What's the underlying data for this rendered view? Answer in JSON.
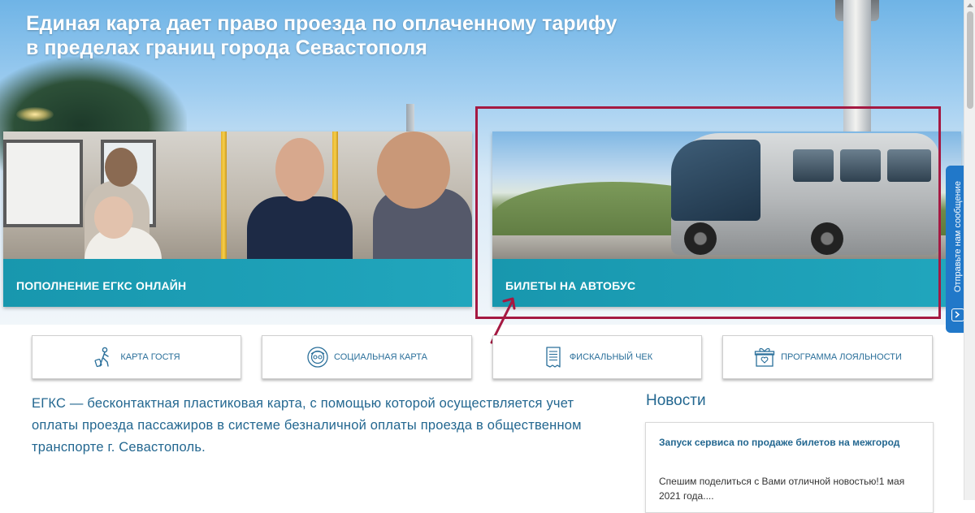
{
  "hero": {
    "title_line_1": "Единая карта дает право проезда по оплаченному тарифу",
    "title_line_2": "в пределах границ города Севастополя"
  },
  "cards": [
    {
      "label": "ПОПОЛНЕНИЕ ЕГКС ОНЛАЙН",
      "photo": "passengers-on-bus"
    },
    {
      "label": "БИЛЕТЫ НА АВТОБУС",
      "photo": "coach-bus-landscape"
    }
  ],
  "highlight": {
    "color": "#a51942"
  },
  "quick_links": [
    {
      "label": "КАРТА ГОСТЯ",
      "icon": "traveler-luggage-icon"
    },
    {
      "label": "СОЦИАЛЬНАЯ КАРТА",
      "icon": "elderly-person-icon"
    },
    {
      "label": "ФИСКАЛЬНЫЙ ЧЕК",
      "icon": "receipt-icon"
    },
    {
      "label": "ПРОГРАММА ЛОЯЛЬНОСТИ",
      "icon": "gift-box-icon"
    }
  ],
  "intro": {
    "text": "ЕГКС — бесконтактная пластиковая карта, с помощью которой осуществляется учет оплаты проезда пассажиров в системе безналичной оплаты проезда в общественном транспорте г. Севастополь."
  },
  "news": {
    "heading": "Новости",
    "items": [
      {
        "title": "Запуск сервиса по продаже билетов на межгород",
        "text": "Спешим поделиться с Вами отличной новостью!1 мая 2021 года...."
      }
    ]
  },
  "feedback": {
    "label": "Отправьте нам сообщение"
  },
  "colors": {
    "accent_teal": "#1c9bb3",
    "link_blue": "#236790",
    "feedback_blue": "#2178c9"
  }
}
